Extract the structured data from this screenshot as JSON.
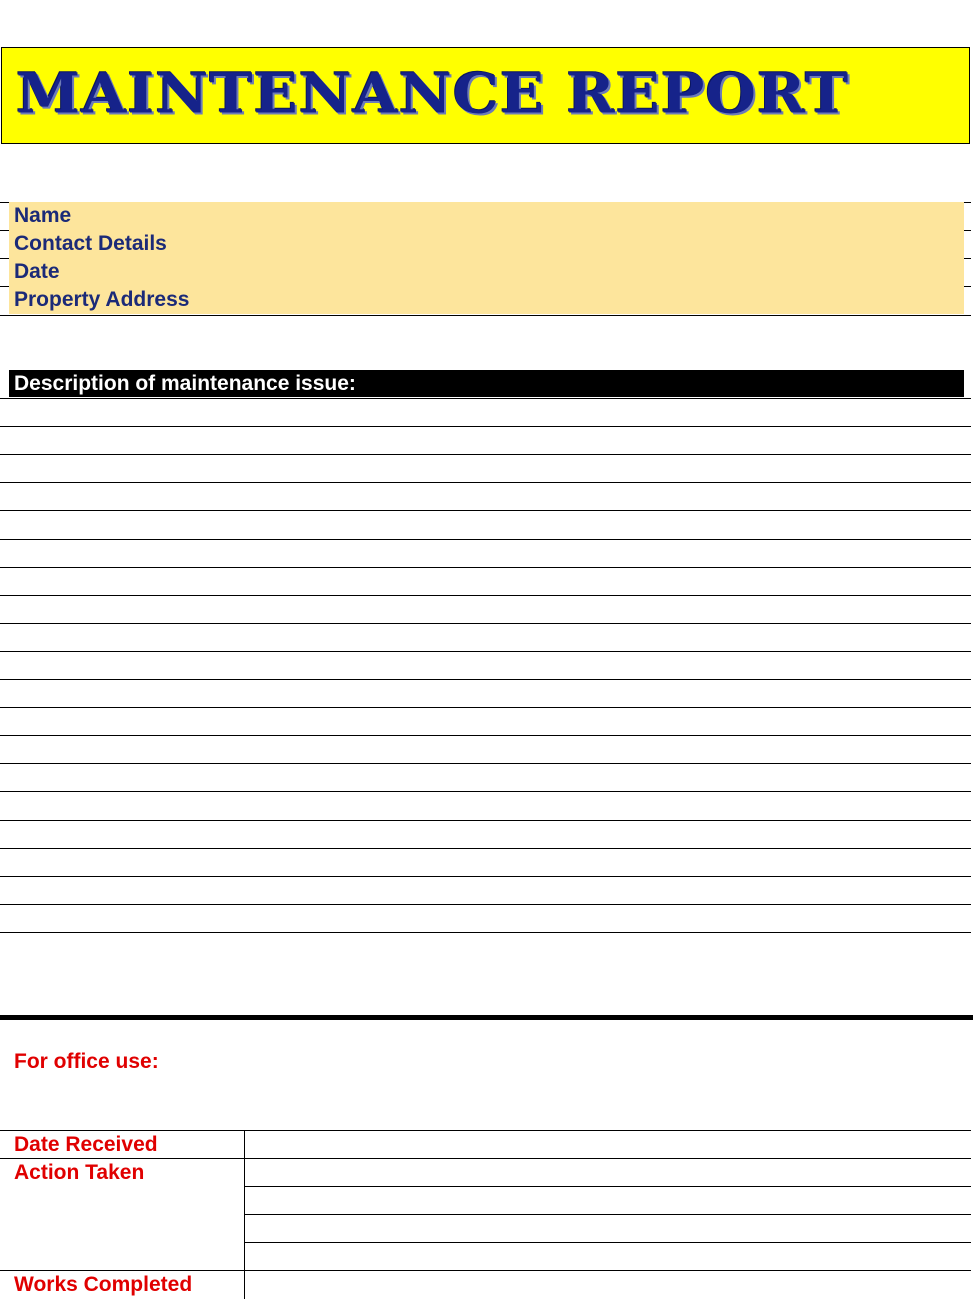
{
  "header": {
    "title": "MAINTENANCE REPORT",
    "background_color": "#ffff00",
    "title_color": "#16238a"
  },
  "info": {
    "fields": [
      {
        "label": "Name",
        "value": ""
      },
      {
        "label": "Contact Details",
        "value": ""
      },
      {
        "label": "Date",
        "value": ""
      },
      {
        "label": "Property Address",
        "value": ""
      }
    ],
    "background_color": "#fde59c"
  },
  "description": {
    "heading": "Description of maintenance issue:",
    "line_count": 20
  },
  "office": {
    "heading": "For office use:",
    "fields": [
      {
        "label": "Date Received",
        "value": ""
      },
      {
        "label": "Action Taken",
        "value": ""
      },
      {
        "label": "Works Completed",
        "value": ""
      }
    ],
    "label_color": "#e00000"
  }
}
